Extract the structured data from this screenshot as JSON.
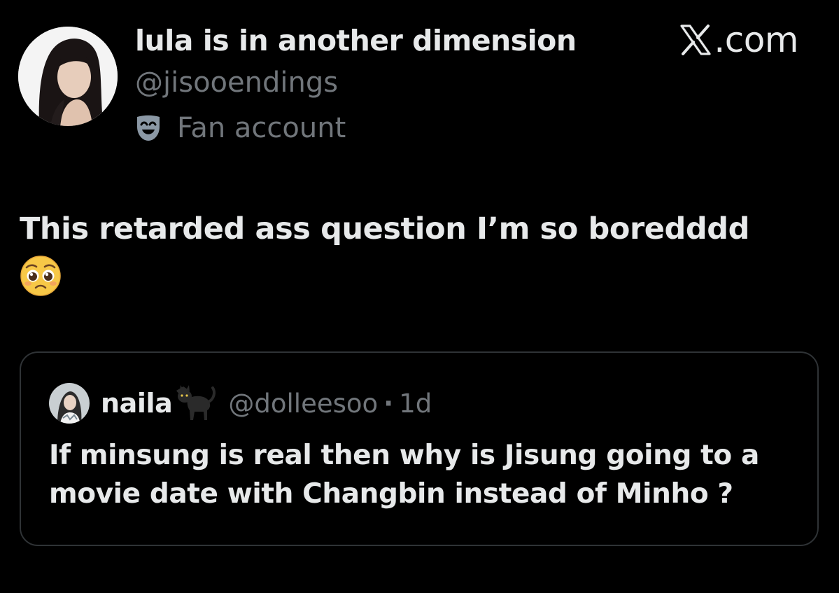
{
  "header": {
    "display_name": "lula is in another dimension",
    "handle": "@jisooendings",
    "badge_label": "Fan account",
    "badge_icon": "theater-mask-icon",
    "site_label": ".com",
    "site_logo": "x-logo-icon"
  },
  "tweet": {
    "text": "This retarded ass question I’m so boredddd",
    "emoji": "pleading-face-emoji"
  },
  "quoted_tweet": {
    "name": "naila",
    "name_emoji": "black-cat-emoji",
    "handle": "@dolleesoo",
    "separator": "·",
    "time": "1d",
    "text": "If minsung is real then why is Jisung going to a movie date with Changbin instead of Minho ?"
  },
  "colors": {
    "background": "#000000",
    "primary_text": "#e7e9ea",
    "secondary_text": "#71767b",
    "border": "#2f3336"
  }
}
